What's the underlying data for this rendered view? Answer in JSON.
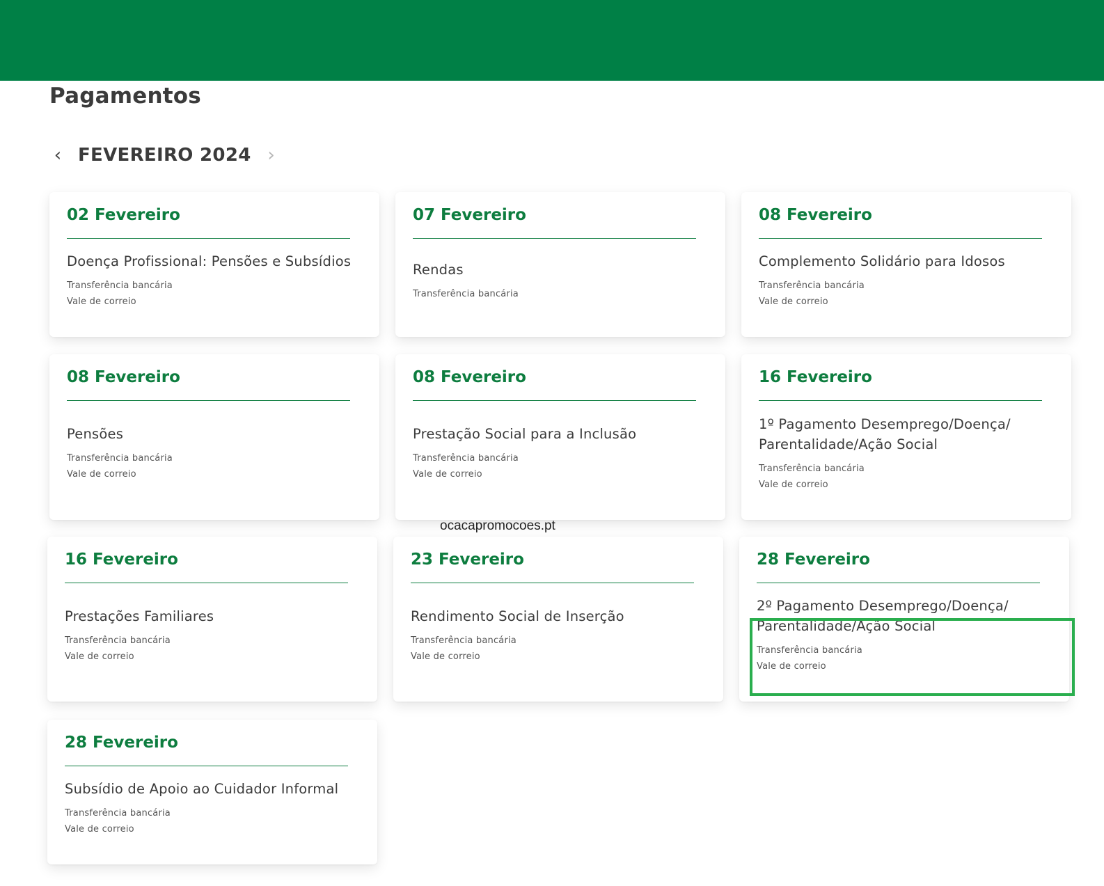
{
  "header": {
    "title": "Pagamentos"
  },
  "month_nav": {
    "prev_icon": "chevron-left-icon",
    "next_icon": "chevron-right-icon",
    "prev_glyph": "‹",
    "next_glyph": "›",
    "label": "FEVEREIRO 2024"
  },
  "cards": [
    {
      "date": "02 Fevereiro",
      "title_lines": [
        "Doença Profissional: Pensões e Subsídios"
      ],
      "methods": [
        "Transferência bancária",
        "Vale de correio"
      ]
    },
    {
      "date": "07 Fevereiro",
      "title_lines": [
        "Rendas"
      ],
      "methods": [
        "Transferência bancária"
      ]
    },
    {
      "date": "08 Fevereiro",
      "title_lines": [
        "Complemento Solidário para Idosos"
      ],
      "methods": [
        "Transferência bancária",
        "Vale de correio"
      ]
    },
    {
      "date": "08 Fevereiro",
      "title_lines": [
        "Pensões"
      ],
      "methods": [
        "Transferência bancária",
        "Vale de correio"
      ]
    },
    {
      "date": "08 Fevereiro",
      "title_lines": [
        "Prestação Social para a Inclusão"
      ],
      "methods": [
        "Transferência bancária",
        "Vale de correio"
      ]
    },
    {
      "date": "16 Fevereiro",
      "title_lines": [
        "1º Pagamento Desemprego/Doença/",
        "Parentalidade/Ação Social"
      ],
      "methods": [
        "Transferência bancária",
        "Vale de correio"
      ]
    },
    {
      "date": "16 Fevereiro",
      "title_lines": [
        "Prestações Familiares"
      ],
      "methods": [
        "Transferência bancária",
        "Vale de correio"
      ]
    },
    {
      "date": "23 Fevereiro",
      "title_lines": [
        "Rendimento Social de Inserção"
      ],
      "methods": [
        "Transferência bancária",
        "Vale de correio"
      ]
    },
    {
      "date": "28 Fevereiro",
      "title_lines": [
        "2º Pagamento Desemprego/Doença/",
        "Parentalidade/Ação Social"
      ],
      "methods": [
        "Transferência bancária",
        "Vale de correio"
      ]
    },
    {
      "date": "28 Fevereiro",
      "title_lines": [
        "Subsídio de Apoio ao Cuidador Informal"
      ],
      "methods": [
        "Transferência bancária",
        "Vale de correio"
      ]
    }
  ],
  "watermark": "ocacapromocoes.pt",
  "colors": {
    "header_bar": "#008046",
    "accent": "#0d7d3f",
    "highlight": "#2aae4e"
  }
}
